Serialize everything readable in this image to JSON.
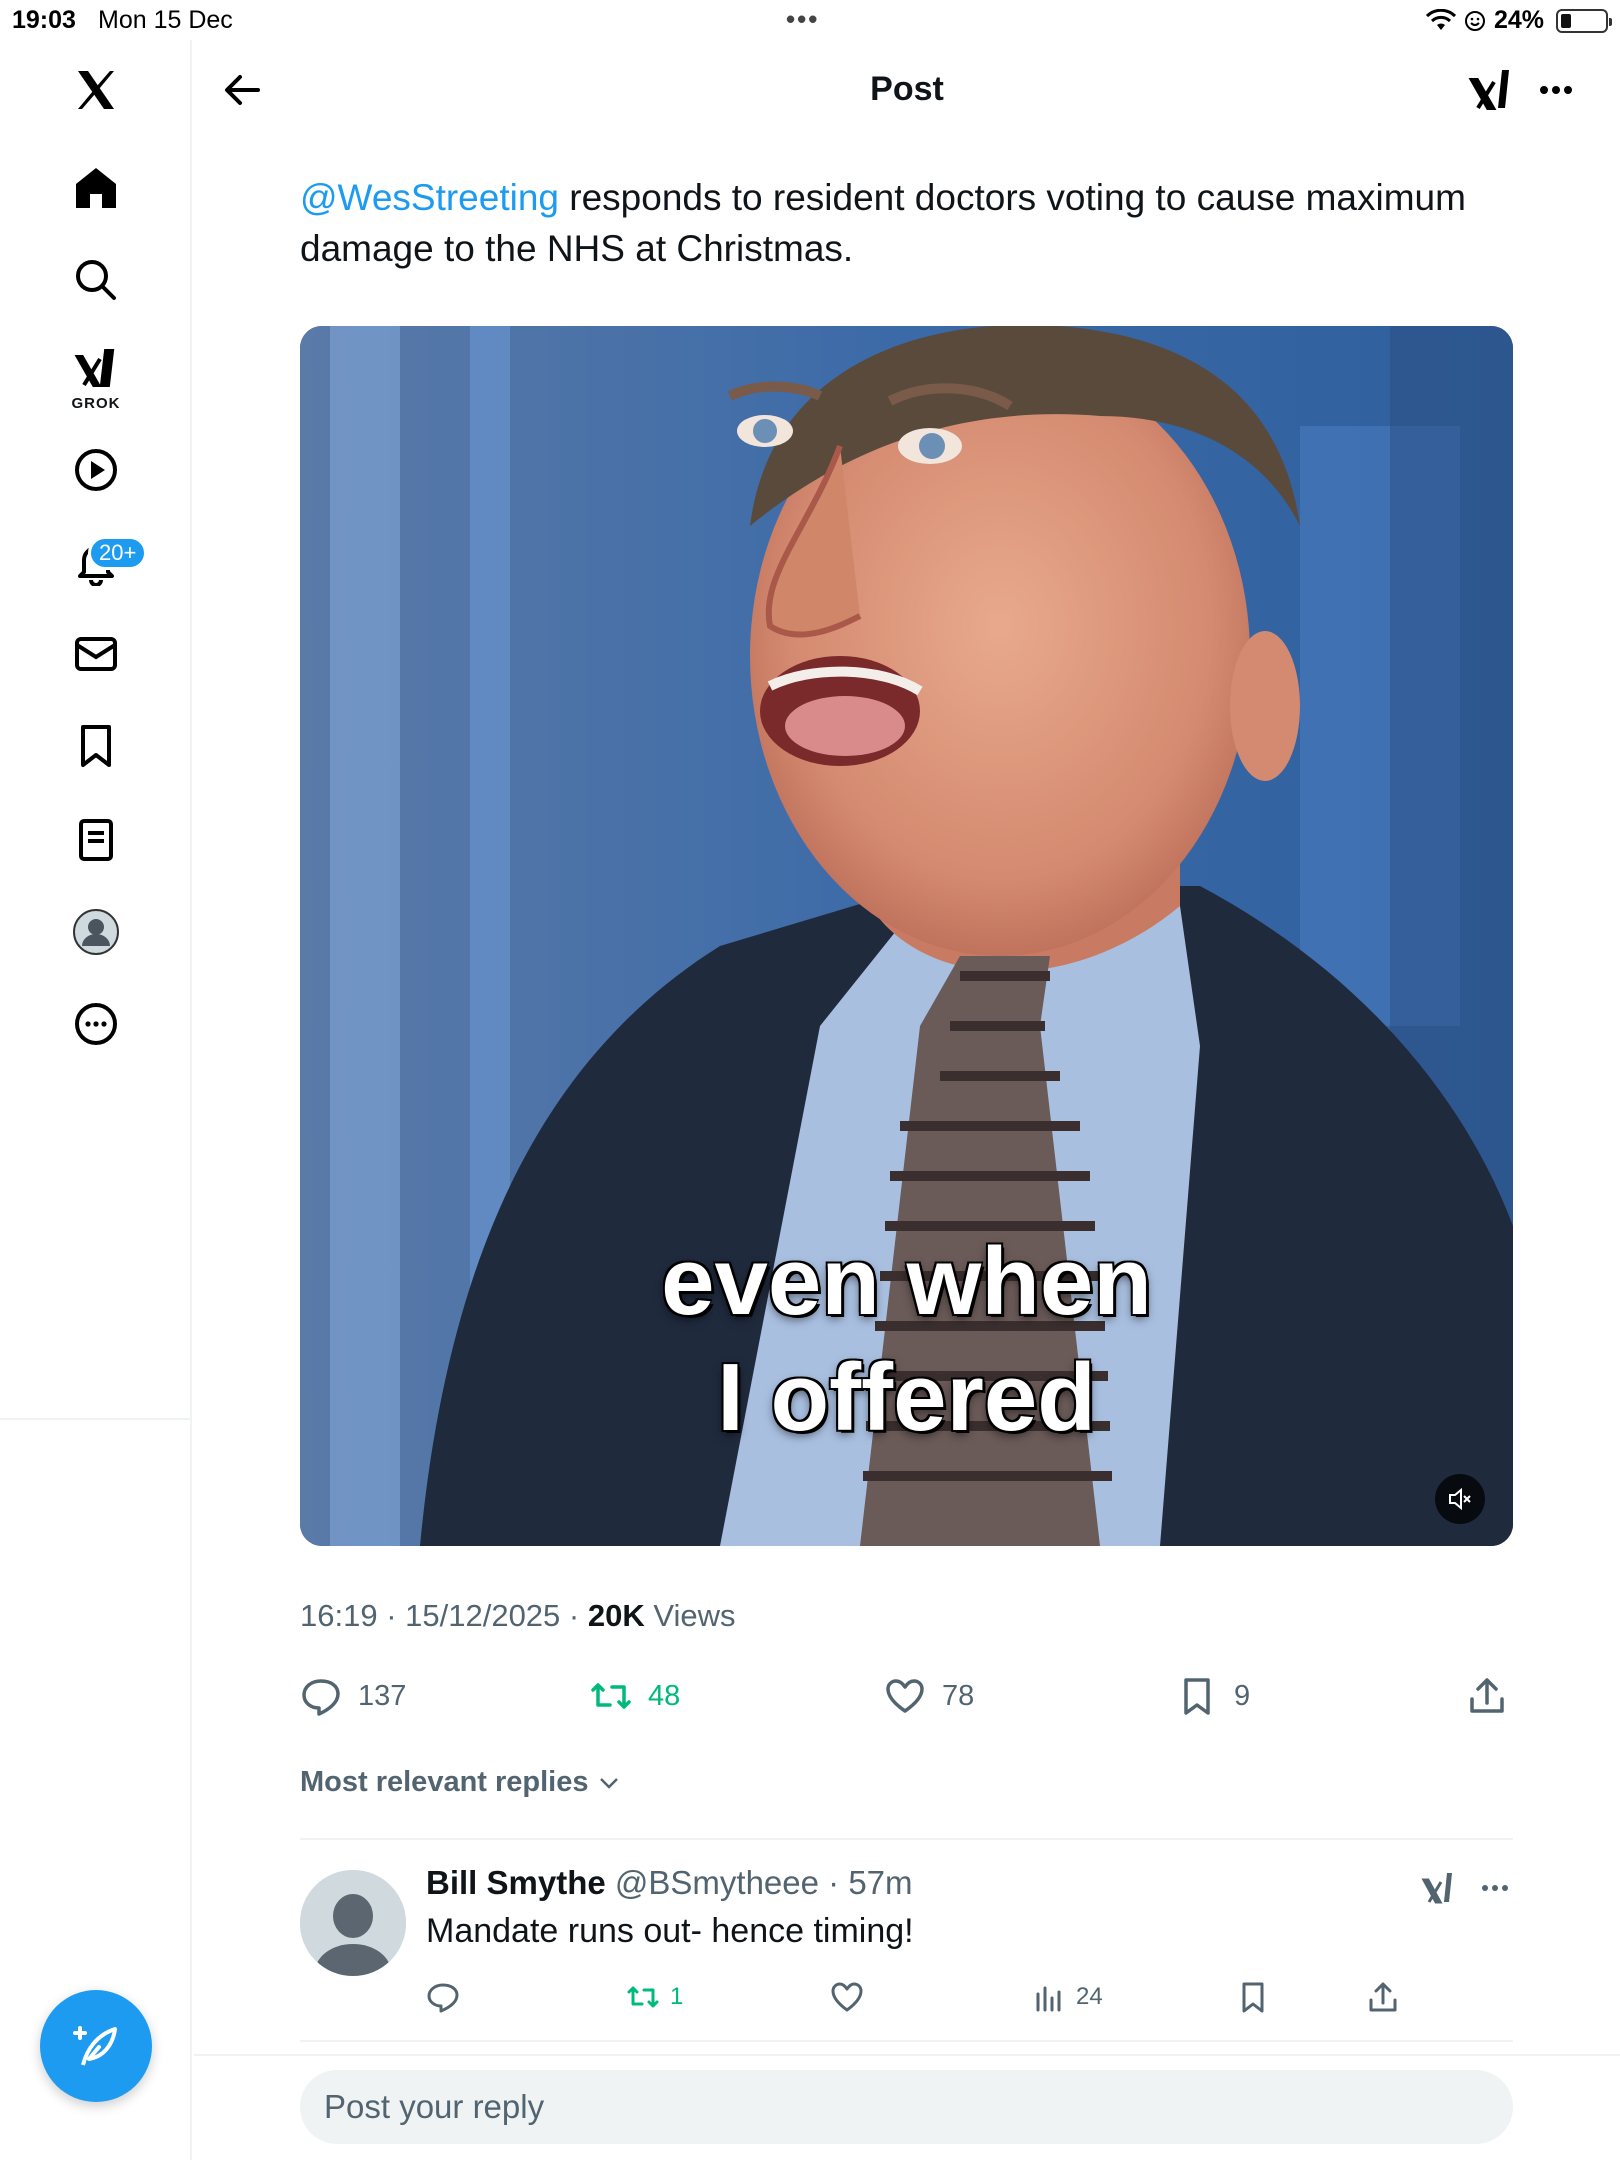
{
  "status_bar": {
    "time": "19:03",
    "date": "Mon 15 Dec",
    "battery_percent": "24%",
    "battery_level": 0.24
  },
  "sidebar": {
    "items": [
      {
        "name": "x-logo-icon"
      },
      {
        "name": "home-icon"
      },
      {
        "name": "search-icon"
      },
      {
        "name": "grok-icon",
        "label": "GROK"
      },
      {
        "name": "video-icon"
      },
      {
        "name": "notifications-icon",
        "badge": "20+"
      },
      {
        "name": "messages-icon"
      },
      {
        "name": "bookmarks-icon"
      },
      {
        "name": "lists-icon"
      },
      {
        "name": "profile-icon"
      },
      {
        "name": "more-icon"
      }
    ],
    "compose_icon": "compose-post-icon"
  },
  "header": {
    "title": "Post"
  },
  "tweet": {
    "mention": "@WesStreeting",
    "text": " responds to resident doctors voting to cause maximum damage to the NHS at Christmas.",
    "media": {
      "caption_line1": "even when",
      "caption_line2": "I offered",
      "muted": true
    },
    "time": "16:19",
    "date": "15/12/2025",
    "views_count": "20K",
    "views_label": "Views",
    "replies": "137",
    "reposts": "48",
    "likes": "78",
    "bookmarks": "9"
  },
  "replies_sort": "Most relevant replies",
  "reply": {
    "name": "Bill Smythe",
    "handle": "@BSmytheee",
    "age": "57m",
    "text": "Mandate runs out- hence timing!",
    "reposts": "1",
    "views": "24"
  },
  "reply_input": {
    "placeholder": "Post your reply"
  },
  "colors": {
    "accent": "#1d9bf0",
    "repost_green": "#00ba7c",
    "secondary_text": "#536471"
  }
}
